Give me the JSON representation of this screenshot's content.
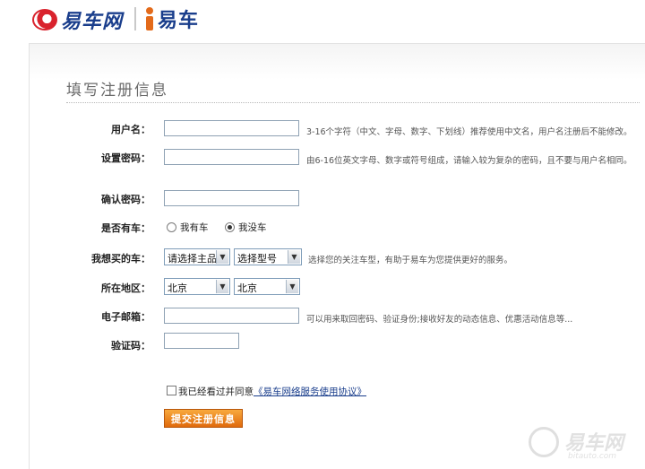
{
  "brand": {
    "logo_main": "易车网",
    "logo_sub": "易车"
  },
  "page": {
    "title": "填写注册信息"
  },
  "form": {
    "username": {
      "label": "用户名：",
      "value": "",
      "hint": "3-16个字符（中文、字母、数字、下划线）推荐使用中文名，用户名注册后不能修改。"
    },
    "password": {
      "label": "设置密码：",
      "value": "",
      "hint": "由6-16位英文字母、数字或符号组成，请输入较为复杂的密码，且不要与用户名相同。"
    },
    "confirm": {
      "label": "确认密码：",
      "value": ""
    },
    "has_car": {
      "label": "是否有车：",
      "options": [
        "我有车",
        "我没车"
      ],
      "selected": "我没车"
    },
    "want_car": {
      "label": "我想买的车：",
      "brand_select": "请选择主品",
      "model_select": "选择型号",
      "hint": "选择您的关注车型，有助于易车为您提供更好的服务。"
    },
    "region": {
      "label": "所在地区：",
      "province": "北京",
      "city": "北京"
    },
    "email": {
      "label": "电子邮箱：",
      "value": "",
      "hint": "可以用来取回密码、验证身份;接收好友的动态信息、优惠活动信息等..."
    },
    "captcha": {
      "label": "验证码：",
      "value": ""
    },
    "agreement": {
      "checked": false,
      "text": "我已经看过并同意",
      "link": "《易车网络服务使用协议》"
    },
    "submit_label": "提交注册信息"
  },
  "watermark": {
    "text": "易车网",
    "sub": "bitauto.com"
  }
}
